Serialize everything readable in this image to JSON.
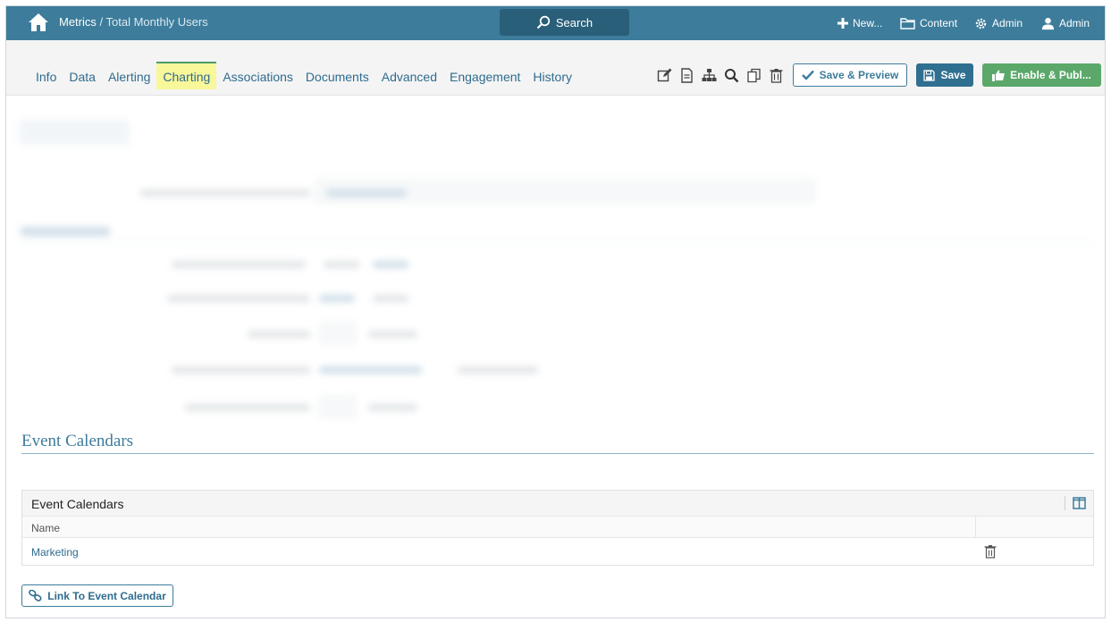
{
  "topbar": {
    "breadcrumb_root": "Metrics",
    "breadcrumb_sep": " / ",
    "breadcrumb_page": "Total Monthly Users",
    "search_label": "Search",
    "new_label": "New...",
    "content_label": "Content",
    "admin_label": "Admin",
    "user_label": "Admin"
  },
  "tabs": [
    {
      "label": "Info"
    },
    {
      "label": "Data"
    },
    {
      "label": "Alerting"
    },
    {
      "label": "Charting"
    },
    {
      "label": "Associations"
    },
    {
      "label": "Documents"
    },
    {
      "label": "Advanced"
    },
    {
      "label": "Engagement"
    },
    {
      "label": "History"
    }
  ],
  "toolbar": {
    "save_preview_label": "Save & Preview",
    "save_label": "Save",
    "enable_label": "Enable & Publ..."
  },
  "event_calendars": {
    "section_title": "Event Calendars",
    "grid_title": "Event Calendars",
    "column_name": "Name",
    "rows": [
      {
        "name": "Marketing"
      }
    ],
    "link_button_label": "Link To Event Calendar"
  },
  "colors": {
    "topbar_bg": "#3d7c9b",
    "accent": "#2e6c8e",
    "active_tab_bg": "#f8f79a",
    "enable_green": "#5ba86a"
  }
}
